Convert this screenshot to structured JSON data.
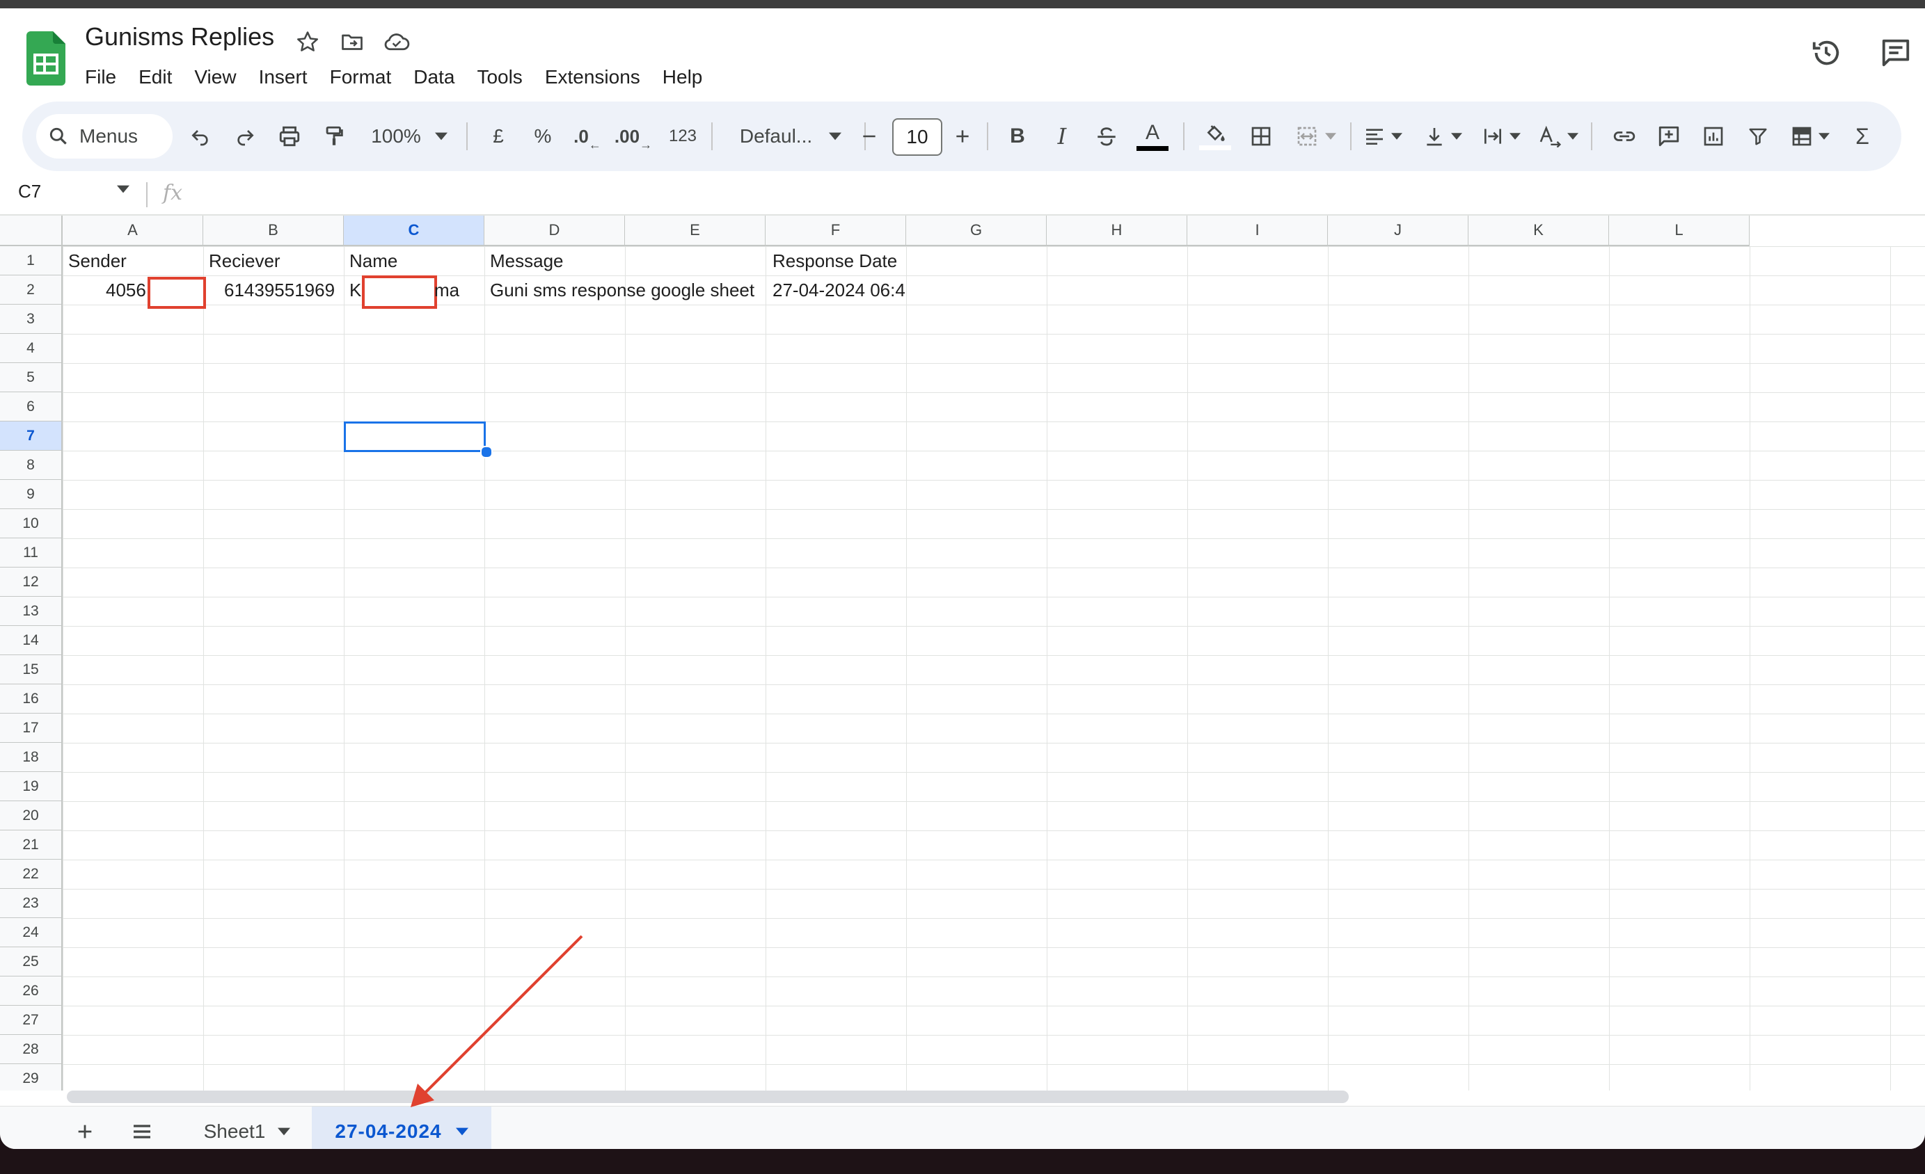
{
  "document": {
    "title": "Gunisms Replies",
    "menus": [
      "File",
      "Edit",
      "View",
      "Insert",
      "Format",
      "Data",
      "Tools",
      "Extensions",
      "Help"
    ]
  },
  "toolbar": {
    "search_label": "Menus",
    "zoom": "100%",
    "currency": "£",
    "percent": "%",
    "decrease_decimal": ".0",
    "increase_decimal": ".00",
    "number_format": "123",
    "font": "Defaul...",
    "font_size": "10",
    "bold": "B",
    "italic": "I",
    "text_color_glyph": "A",
    "sum": "Σ"
  },
  "formula_bar": {
    "name_box": "C7",
    "fx": "fx"
  },
  "grid": {
    "columns": [
      "A",
      "B",
      "C",
      "D",
      "E",
      "F",
      "G",
      "H",
      "I",
      "J",
      "K",
      "L"
    ],
    "rows": [
      "1",
      "2",
      "3",
      "4",
      "5",
      "6",
      "7",
      "8",
      "9",
      "10",
      "11",
      "12",
      "13",
      "14",
      "15",
      "16",
      "17",
      "18",
      "19",
      "20",
      "21",
      "22",
      "23",
      "24",
      "25",
      "26",
      "27",
      "28",
      "29"
    ],
    "selected_column": "C",
    "selected_row": "7",
    "header_row": [
      "Sender",
      "Reciever",
      "Name",
      "Message",
      "Response Date"
    ],
    "data_row": {
      "sender": "4056",
      "receiver": "61439551969",
      "name_start": "K",
      "name_end": "ma",
      "message": "Guni sms response google sheet",
      "response_date": "27-04-2024 06:4"
    }
  },
  "sheets": {
    "tabs": [
      "Sheet1",
      "27-04-2024"
    ],
    "active": "27-04-2024"
  },
  "colors": {
    "accent": "#0b57d0",
    "selection": "#1a73e8",
    "annotation": "#e0412f",
    "sheets_green": "#34a853"
  }
}
